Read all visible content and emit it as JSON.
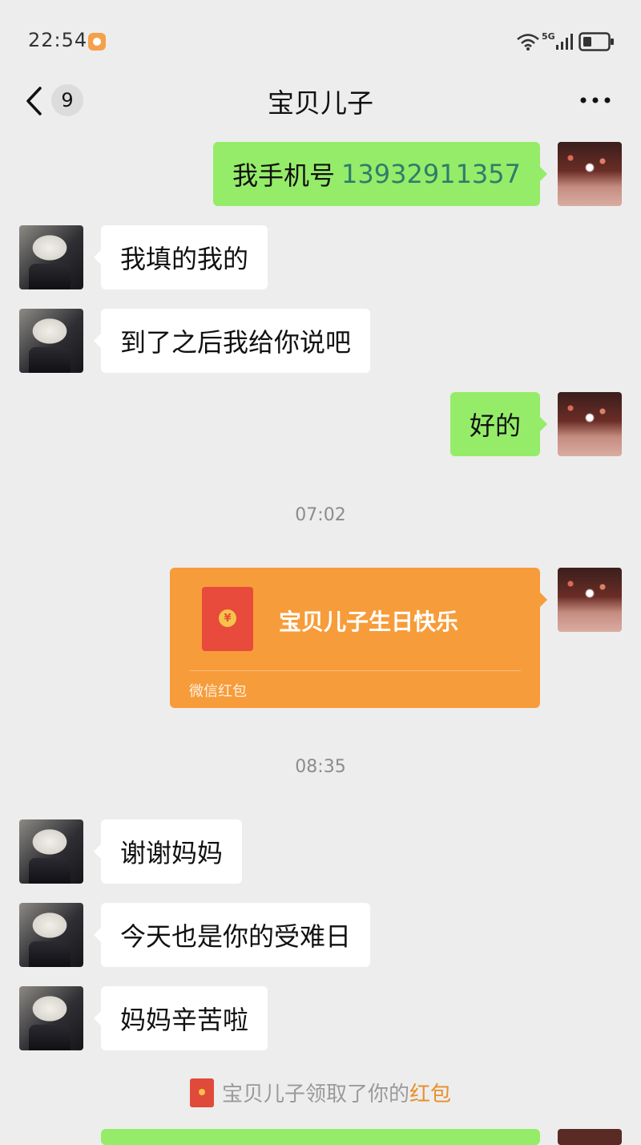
{
  "status_bar": {
    "time": "22:54",
    "network": "5G"
  },
  "nav": {
    "back_count": "9",
    "title": "宝贝儿子"
  },
  "messages": [
    {
      "side": "right",
      "text": "我手机号 ",
      "phone": "13932911357"
    },
    {
      "side": "left",
      "text": "我填的我的"
    },
    {
      "side": "left",
      "text": "到了之后我给你说吧"
    },
    {
      "side": "right",
      "text": "好的"
    },
    {
      "timestamp": "07:02"
    },
    {
      "side": "right",
      "type": "red_packet",
      "title": "宝贝儿子生日快乐",
      "label": "微信红包"
    },
    {
      "timestamp": "08:35"
    },
    {
      "side": "left",
      "text": "谢谢妈妈"
    },
    {
      "side": "left",
      "text": "今天也是你的受难日"
    },
    {
      "side": "left",
      "text": "妈妈辛苦啦"
    }
  ],
  "notice": {
    "text": "宝贝儿子领取了你的",
    "link": "红包"
  },
  "colors": {
    "self_bubble": "#95ec69",
    "other_bubble": "#ffffff",
    "red_packet": "#f79c3a",
    "background": "#ededed"
  },
  "icons": [
    "back-icon",
    "more-icon",
    "wifi-icon",
    "signal-icon",
    "battery-icon",
    "red-packet-icon"
  ]
}
